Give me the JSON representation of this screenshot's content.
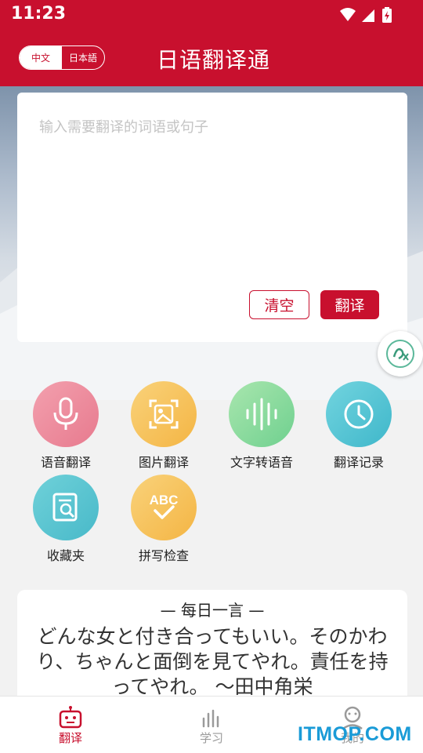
{
  "status_bar": {
    "time": "11:23"
  },
  "header": {
    "lang_options": [
      "中文",
      "日本語"
    ],
    "title": "日语翻译通"
  },
  "input": {
    "placeholder": "输入需要翻译的词语或句子",
    "clear_label": "清空",
    "translate_label": "翻译"
  },
  "features": [
    {
      "label": "语音翻译",
      "icon": "microphone-icon",
      "color": "#ee8b9c"
    },
    {
      "label": "图片翻译",
      "icon": "image-scan-icon",
      "color": "#f7c25a"
    },
    {
      "label": "文字转语音",
      "icon": "soundwave-icon",
      "color": "#8fdc9c"
    },
    {
      "label": "翻译记录",
      "icon": "clock-icon",
      "color": "#58c7d5"
    },
    {
      "label": "收藏夹",
      "icon": "document-search-icon",
      "color": "#58c3cf"
    },
    {
      "label": "拼写检查",
      "icon": "abc-check-icon",
      "color": "#f7c25a"
    }
  ],
  "quote": {
    "title": "— 每日一言 —",
    "text": "どんな女と付き合ってもいい。そのかわり、ちゃんと面倒を見てやれ。責任を持ってやれ。 〜田中角栄"
  },
  "tabs": [
    {
      "label": "翻译",
      "icon": "robot-icon"
    },
    {
      "label": "学习",
      "icon": "bars-icon"
    },
    {
      "label": "我的",
      "icon": "user-icon"
    }
  ],
  "watermark": "ITMOP.COM",
  "colors": {
    "brand": "#c8102e",
    "tab_inactive": "#9a9a9a",
    "watermark": "#1a9bd7"
  }
}
